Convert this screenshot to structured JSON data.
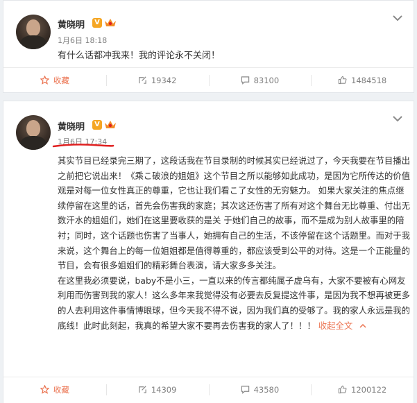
{
  "posts": [
    {
      "author": "黄晓明",
      "verified_mark": "V",
      "time": "1月6日 18:18",
      "text": "有什么话都冲我来！我的评论永不关闭！",
      "actions": {
        "favorite_label": "收藏",
        "repost_count": "19342",
        "comment_count": "83100",
        "like_count": "1484518"
      }
    },
    {
      "author": "黄晓明",
      "verified_mark": "V",
      "time": "1月6日 17:34",
      "paragraphs": [
        "其实节目已经录完三期了，这段话我在节目录制的时候其实已经说过了，今天我要在节目播出之前把它说出来！《乘こ破浪的姐姐》这个节目之所以能够如此成功，是因为它所传达的价值观是对每一位女性真正的尊重，它也让我们看こ了女性的无穷魅力。 如果大家关注的焦点继续停留在这里的话，首先会伤害我的家庭；其次这还伤害了所有对这个舞台无比尊重、付出无数汗水的姐姐们，她们在这里要收获的是关 于她们自己的故事，而不是成为别人故事里的陪衬；同时，这个话题也伤害了当事人，她拥有自己的生活，不该停留在这个话题里。而对于我来说，这个舞台上的每一位姐姐都是值得尊重的，都应该受到公平的对待。这是一个正能量的节目，会有很多姐姐们的精彩舞台表演，请大家多多关注。",
        "在这里我必须要说，baby不是小三，一直以来的传言都纯属子虚乌有，大家不要被有心网友利用而伤害到我的家人！这么多年来我觉得没有必要去反复提这件事，是因为我不想再被更多的人去利用这件事情博眼球，但今天我不得不说，因为我们真的受够了。我的家人永远是我的底线！此时此刻起，我真的希望大家不要再去伤害我的家人了！！！"
      ],
      "collapse_label": "收起全文",
      "actions": {
        "favorite_label": "收藏",
        "repost_count": "14309",
        "comment_count": "43580",
        "like_count": "1200122"
      }
    }
  ],
  "colors": {
    "accent": "#eb7350",
    "verified": "#f5a623",
    "underline": "#e02020"
  },
  "icons": [
    "avatar",
    "verified-v-icon",
    "vip-crown-icon",
    "chevron-down-icon",
    "star-icon",
    "repost-icon",
    "comment-icon",
    "like-icon"
  ]
}
